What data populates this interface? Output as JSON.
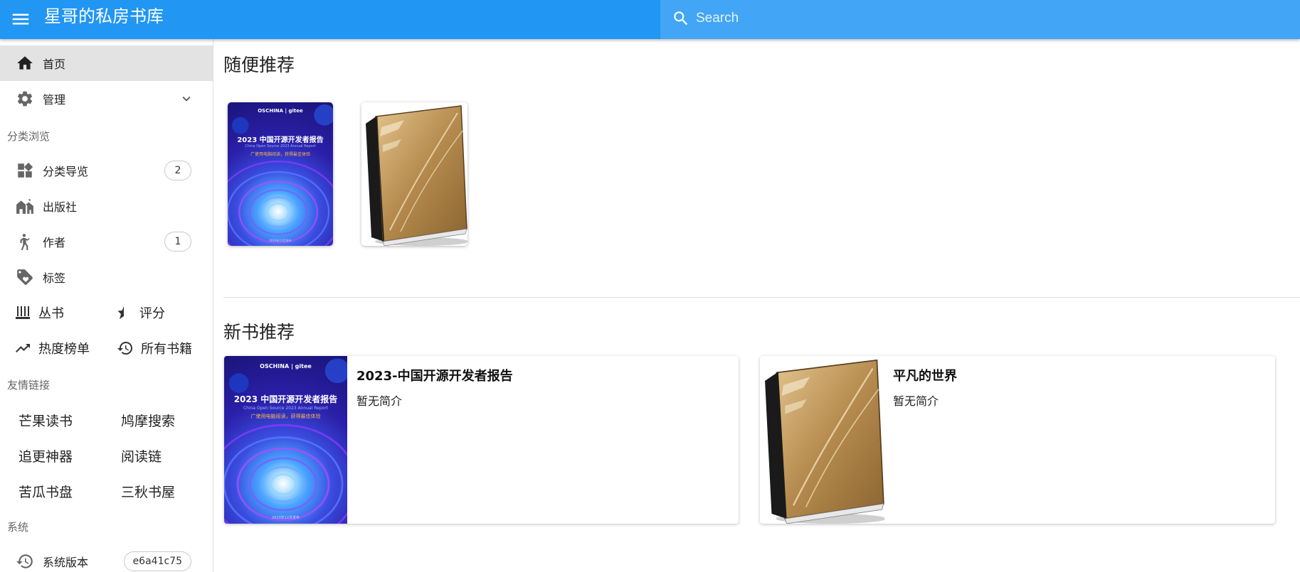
{
  "header": {
    "title": "星哥的私房书库",
    "search_placeholder": "Search",
    "brand_color": "#2196f3",
    "search_bg_color": "#42a5f5"
  },
  "sidebar": {
    "home": "首页",
    "manage": "管理",
    "browse_header": "分类浏览",
    "category_nav": "分类导览",
    "category_nav_count": "2",
    "publisher": "出版社",
    "author": "作者",
    "author_count": "1",
    "tags": "标签",
    "series": "丛书",
    "rating": "评分",
    "hot": "热度榜单",
    "all_books": "所有书籍",
    "links_header": "友情链接",
    "links": [
      "芒果读书",
      "鸠摩搜索",
      "追更神器",
      "阅读链",
      "苦瓜书盘",
      "三秋书屋"
    ],
    "system_header": "系统",
    "version_label": "系统版本",
    "version_value": "e6a41c75"
  },
  "main": {
    "random_title": "随便推荐",
    "new_title": "新书推荐",
    "new_books": [
      {
        "title": "2023-中国开源开发者报告",
        "desc": "暂无简介"
      },
      {
        "title": "平凡的世界",
        "desc": "暂无简介"
      }
    ]
  },
  "cover": {
    "logo_left": "OSCHINA",
    "logo_right": "gitee",
    "title": "2023 中国开源开发者报告",
    "subtitle": "China Open Source 2023 Annual Report",
    "tagline": "广使用电脑阅读，获得最佳体验",
    "footer": "2023年12月发布"
  }
}
